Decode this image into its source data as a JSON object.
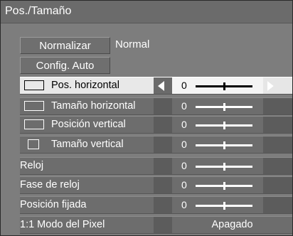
{
  "menu": {
    "title": "Pos./Tamaño",
    "normalize_label": "Normalizar",
    "normalize_status": "Normal",
    "auto_setup_label": "Config. Auto"
  },
  "settings": [
    {
      "label": "Pos. horizontal",
      "icon": "horizontal-position-icon",
      "value": "0",
      "level": 0.5,
      "selected": true
    },
    {
      "label": "Tamaño horizontal",
      "icon": "horizontal-size-icon",
      "value": "0",
      "level": 0.5,
      "selected": false
    },
    {
      "label": "Posición vertical",
      "icon": "vertical-position-icon",
      "value": "0",
      "level": 0.5,
      "selected": false
    },
    {
      "label": "Tamaño vertical",
      "icon": "vertical-size-icon",
      "value": "0",
      "level": 0.5,
      "selected": false
    },
    {
      "label": "Reloj",
      "icon": "",
      "value": "0",
      "level": 0.5,
      "selected": false
    },
    {
      "label": "Fase de reloj",
      "icon": "",
      "value": "0",
      "level": 0.5,
      "selected": false
    },
    {
      "label": "Posición fijada",
      "icon": "",
      "value": "0",
      "level": 0.5,
      "selected": false
    }
  ],
  "pixel_mode": {
    "label": "1:1 Modo del Pixel",
    "value": "Apagado"
  },
  "colors": {
    "panel": "#7d7d7d",
    "row": "#6d6d6d",
    "selected_row": "#e8e8e8",
    "text": "#ffffff"
  }
}
